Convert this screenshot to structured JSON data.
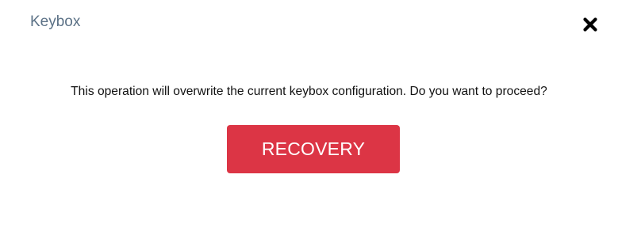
{
  "dialog": {
    "title": "Keybox",
    "close_icon": "close-icon",
    "message": "This operation will overwrite the current keybox configuration. Do you want to proceed?",
    "primary_button_label": "RECOVERY"
  },
  "colors": {
    "title": "#5b7186",
    "primary_button": "#dc3545",
    "primary_button_text": "#ffffff",
    "message_text": "#111111",
    "close_icon": "#000000"
  }
}
